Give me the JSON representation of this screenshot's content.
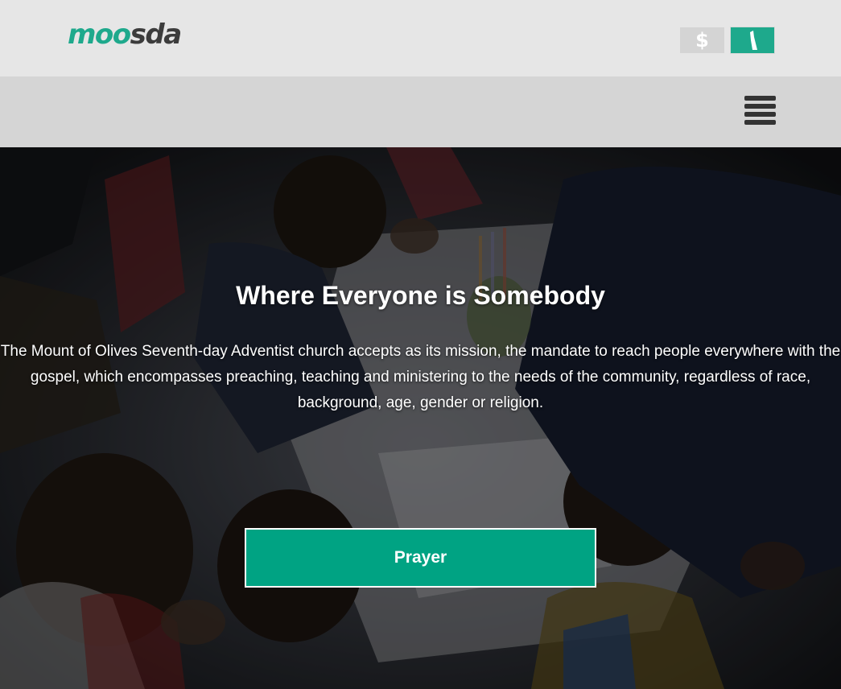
{
  "header": {
    "logo": {
      "part_a": "moo",
      "part_b": "sda"
    },
    "donate_label": "$",
    "church_icon": "church-icon"
  },
  "nav": {
    "menu_icon": "hamburger-menu-icon"
  },
  "hero": {
    "title": "Where Everyone is Somebody",
    "text": "The Mount of Olives Seventh-day Adventist church accepts as its mission, the mandate to reach people everywhere with the gospel, which encompasses preaching, teaching and ministering to the needs of the community, regardless of race, background, age, gender or religion.",
    "button_label": "Prayer",
    "background_image": "children-at-table-photo"
  },
  "colors": {
    "brand_teal": "#1ea98c",
    "button_teal": "#00a383",
    "topbar_bg": "#e6e6e6",
    "navbar_bg": "#d5d5d5",
    "logo_dark": "#3c3c3c"
  }
}
